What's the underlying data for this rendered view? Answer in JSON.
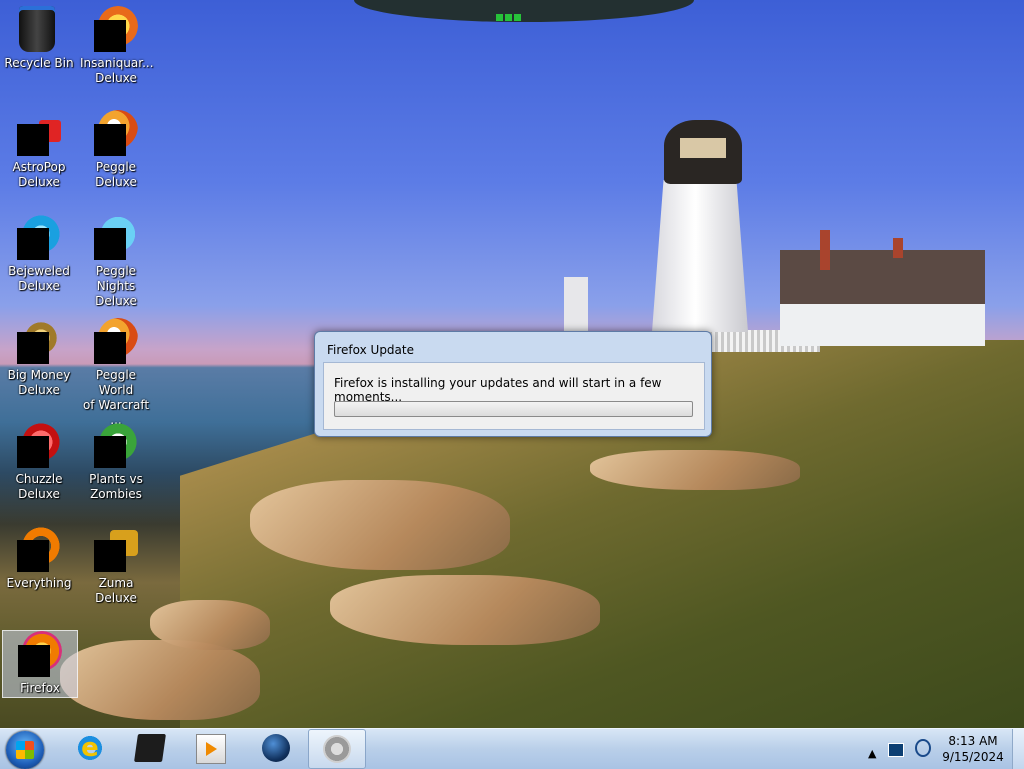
{
  "desktop": {
    "icons": [
      {
        "label": "Recycle Bin",
        "icon": "recycle-bin-icon"
      },
      {
        "label": "Insaniquar...\nDeluxe",
        "icon": "insaniquarium-icon"
      },
      {
        "label": "AstroPop\nDeluxe",
        "icon": "astropop-icon"
      },
      {
        "label": "Peggle Deluxe",
        "icon": "peggle-icon"
      },
      {
        "label": "Bejeweled\nDeluxe",
        "icon": "bejeweled-icon"
      },
      {
        "label": "Peggle Nights\nDeluxe",
        "icon": "peggle-nights-icon"
      },
      {
        "label": "Big Money\nDeluxe",
        "icon": "big-money-icon"
      },
      {
        "label": "Peggle World\nof Warcraft ...",
        "icon": "peggle-wow-icon"
      },
      {
        "label": "Chuzzle\nDeluxe",
        "icon": "chuzzle-icon"
      },
      {
        "label": "Plants vs\nZombies",
        "icon": "plants-vs-zombies-icon"
      },
      {
        "label": "Everything",
        "icon": "everything-icon"
      },
      {
        "label": "Zuma Deluxe",
        "icon": "zuma-icon"
      },
      {
        "label": "Firefox",
        "icon": "firefox-icon"
      }
    ]
  },
  "dialog": {
    "title": "Firefox Update",
    "message": "Firefox is installing your updates and will start in a few moments...",
    "progress": 0
  },
  "taskbar": {
    "start_icon": "windows-start-icon",
    "pinned": [
      "internet-explorer-icon",
      "terminal-icon",
      "media-player-icon",
      "globe-icon",
      "firefox-updater-icon"
    ],
    "tray_icons": [
      "show-hidden-icons-icon",
      "action-center-flag-icon",
      "network-icon"
    ],
    "time": "8:13 AM",
    "date": "9/15/2024"
  }
}
